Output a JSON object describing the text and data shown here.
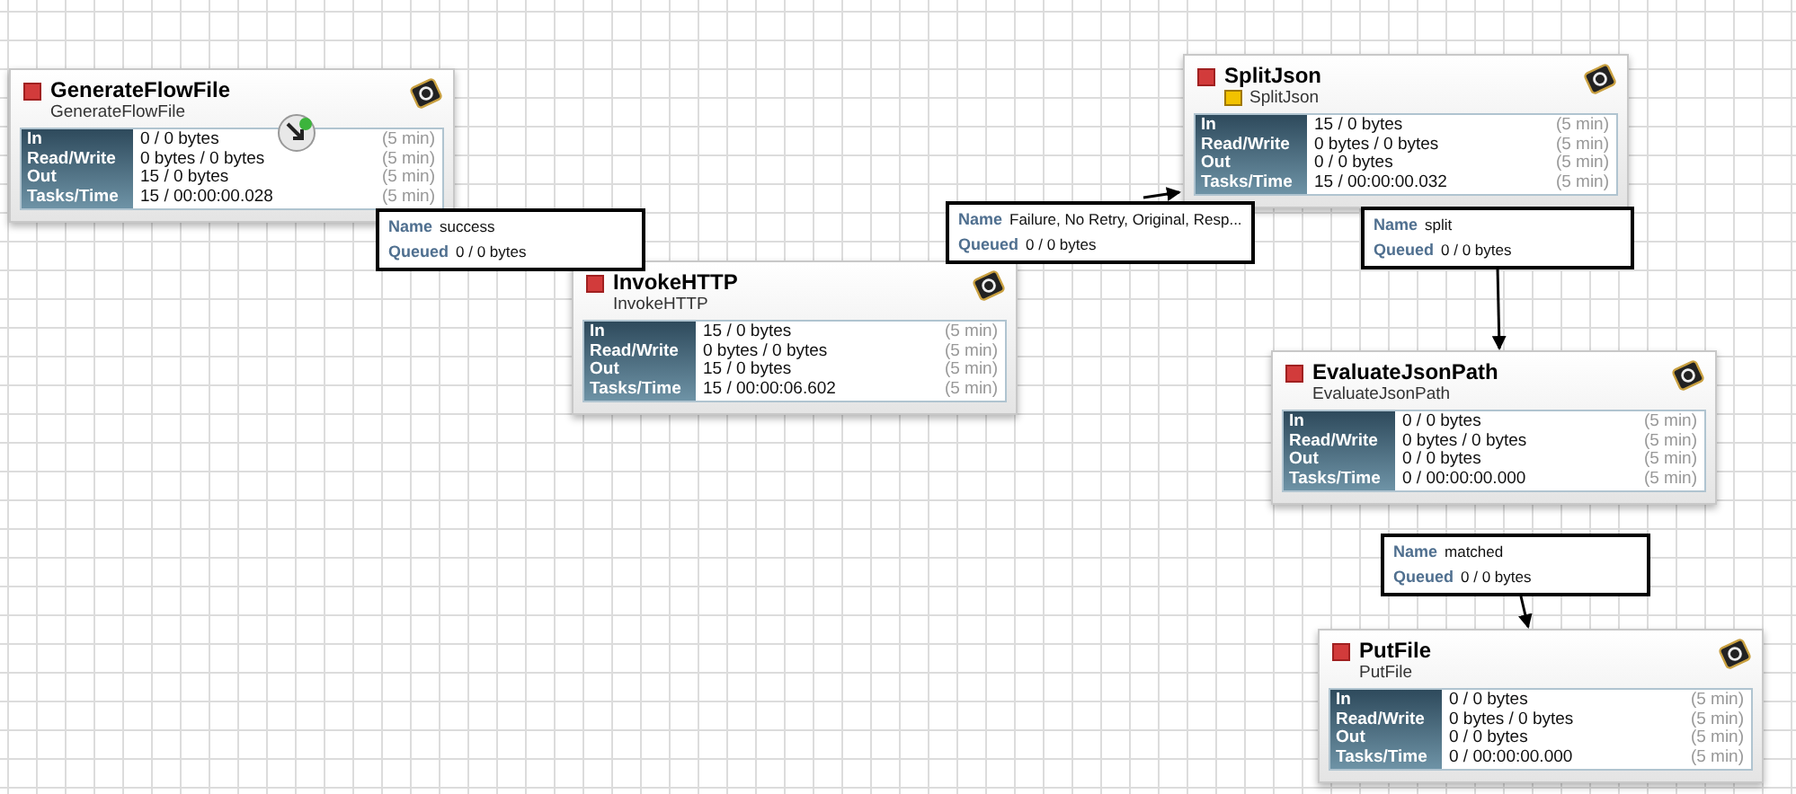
{
  "processors": [
    {
      "name": "GenerateFlowFile",
      "type": "GenerateFlowFile",
      "type_badge": false,
      "connect_handle": true,
      "stats": [
        {
          "label": "In",
          "value": "0 / 0 bytes",
          "window": "(5 min)"
        },
        {
          "label": "Read/Write",
          "value": "0 bytes / 0 bytes",
          "window": "(5 min)"
        },
        {
          "label": "Out",
          "value": "15 / 0 bytes",
          "window": "(5 min)"
        },
        {
          "label": "Tasks/Time",
          "value": "15 / 00:00:00.028",
          "window": "(5 min)"
        }
      ]
    },
    {
      "name": "InvokeHTTP",
      "type": "InvokeHTTP",
      "type_badge": false,
      "connect_handle": false,
      "stats": [
        {
          "label": "In",
          "value": "15 / 0 bytes",
          "window": "(5 min)"
        },
        {
          "label": "Read/Write",
          "value": "0 bytes / 0 bytes",
          "window": "(5 min)"
        },
        {
          "label": "Out",
          "value": "15 / 0 bytes",
          "window": "(5 min)"
        },
        {
          "label": "Tasks/Time",
          "value": "15 / 00:00:06.602",
          "window": "(5 min)"
        }
      ]
    },
    {
      "name": "SplitJson",
      "type": "SplitJson",
      "type_badge": true,
      "connect_handle": false,
      "stats": [
        {
          "label": "In",
          "value": "15 / 0 bytes",
          "window": "(5 min)"
        },
        {
          "label": "Read/Write",
          "value": "0 bytes / 0 bytes",
          "window": "(5 min)"
        },
        {
          "label": "Out",
          "value": "0 / 0 bytes",
          "window": "(5 min)"
        },
        {
          "label": "Tasks/Time",
          "value": "15 / 00:00:00.032",
          "window": "(5 min)"
        }
      ]
    },
    {
      "name": "EvaluateJsonPath",
      "type": "EvaluateJsonPath",
      "type_badge": false,
      "connect_handle": false,
      "stats": [
        {
          "label": "In",
          "value": "0 / 0 bytes",
          "window": "(5 min)"
        },
        {
          "label": "Read/Write",
          "value": "0 bytes / 0 bytes",
          "window": "(5 min)"
        },
        {
          "label": "Out",
          "value": "0 / 0 bytes",
          "window": "(5 min)"
        },
        {
          "label": "Tasks/Time",
          "value": "0 / 00:00:00.000",
          "window": "(5 min)"
        }
      ]
    },
    {
      "name": "PutFile",
      "type": "PutFile",
      "type_badge": false,
      "connect_handle": false,
      "stats": [
        {
          "label": "In",
          "value": "0 / 0 bytes",
          "window": "(5 min)"
        },
        {
          "label": "Read/Write",
          "value": "0 bytes / 0 bytes",
          "window": "(5 min)"
        },
        {
          "label": "Out",
          "value": "0 / 0 bytes",
          "window": "(5 min)"
        },
        {
          "label": "Tasks/Time",
          "value": "0 / 00:00:00.000",
          "window": "(5 min)"
        }
      ]
    }
  ],
  "connections": [
    {
      "name_label": "Name",
      "name": "success",
      "queued_label": "Queued",
      "queued": "0 / 0 bytes"
    },
    {
      "name_label": "Name",
      "name": "Failure, No Retry, Original, Resp...",
      "queued_label": "Queued",
      "queued": "0 / 0 bytes"
    },
    {
      "name_label": "Name",
      "name": "split",
      "queued_label": "Queued",
      "queued": "0 / 0 bytes"
    },
    {
      "name_label": "Name",
      "name": "matched",
      "queued_label": "Queued",
      "queued": "0 / 0 bytes"
    }
  ]
}
